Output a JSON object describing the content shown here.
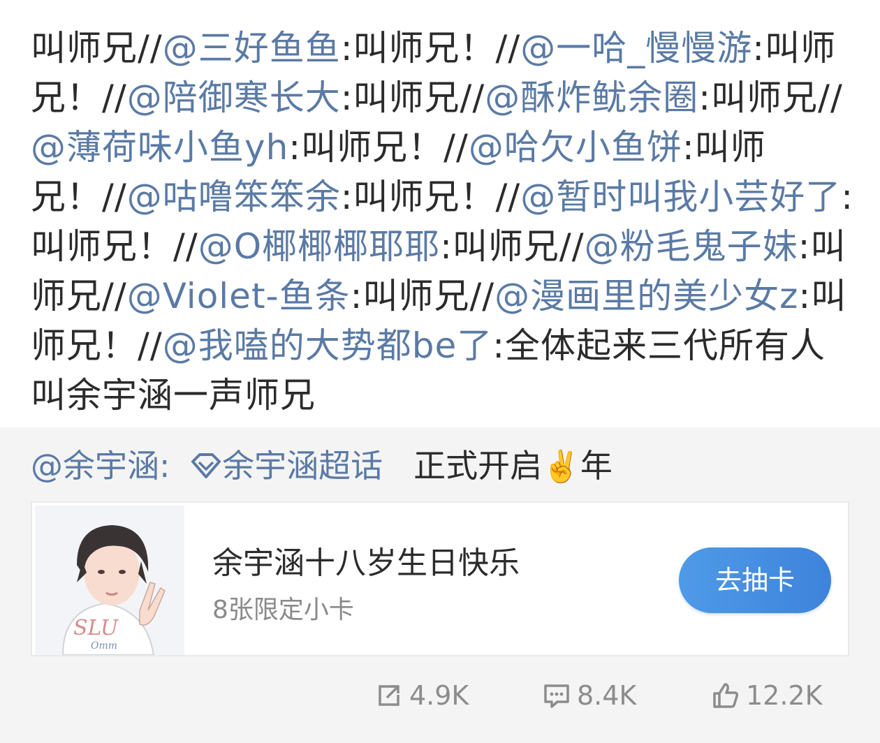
{
  "post": {
    "segments": [
      {
        "text": "叫师兄//",
        "mention": false
      },
      {
        "text": "@三好鱼鱼",
        "mention": true
      },
      {
        "text": ":叫师兄！//",
        "mention": false
      },
      {
        "text": "@一哈_慢慢游",
        "mention": true
      },
      {
        "text": ":叫师兄！//",
        "mention": false
      },
      {
        "text": "@陪御寒长大",
        "mention": true
      },
      {
        "text": ":叫师兄//",
        "mention": false
      },
      {
        "text": "@酥炸鱿余圈",
        "mention": true
      },
      {
        "text": ":叫师兄//",
        "mention": false
      },
      {
        "text": "@薄荷味小鱼yh",
        "mention": true
      },
      {
        "text": ":叫师兄！//",
        "mention": false
      },
      {
        "text": "@哈欠小鱼饼",
        "mention": true
      },
      {
        "text": ":叫师兄！//",
        "mention": false
      },
      {
        "text": "@咕噜笨笨余",
        "mention": true
      },
      {
        "text": ":叫师兄！//",
        "mention": false
      },
      {
        "text": "@暂时叫我小芸好了",
        "mention": true
      },
      {
        "text": ":叫师兄！//",
        "mention": false
      },
      {
        "text": "@O椰椰椰耶耶",
        "mention": true
      },
      {
        "text": ":叫师兄//",
        "mention": false
      },
      {
        "text": "@粉毛鬼子妹",
        "mention": true
      },
      {
        "text": ":叫师兄//",
        "mention": false
      },
      {
        "text": "@Violet-鱼条",
        "mention": true
      },
      {
        "text": ":叫师兄//",
        "mention": false
      },
      {
        "text": "@漫画里的美少女z",
        "mention": true
      },
      {
        "text": ":叫师兄！//",
        "mention": false
      },
      {
        "text": "@我嗑的大势都be了",
        "mention": true
      },
      {
        "text": ":全体起来三代所有人叫余宇涵一声师兄",
        "mention": false
      }
    ]
  },
  "retweet": {
    "author": "@余宇涵:",
    "topic": "余宇涵超话",
    "text": "正式开启",
    "emoji": "✌️",
    "text_after": "年"
  },
  "card": {
    "title": "余宇涵十八岁生日快乐",
    "subtitle": "8张限定小卡",
    "button": "去抽卡"
  },
  "actions": {
    "repost": "4.9K",
    "comment": "8.4K",
    "like": "12.2K"
  },
  "colors": {
    "mention": "#5a7aa5",
    "button": "#4a90e2",
    "muted": "#8c8c8c",
    "panel": "#f4f4f4"
  }
}
